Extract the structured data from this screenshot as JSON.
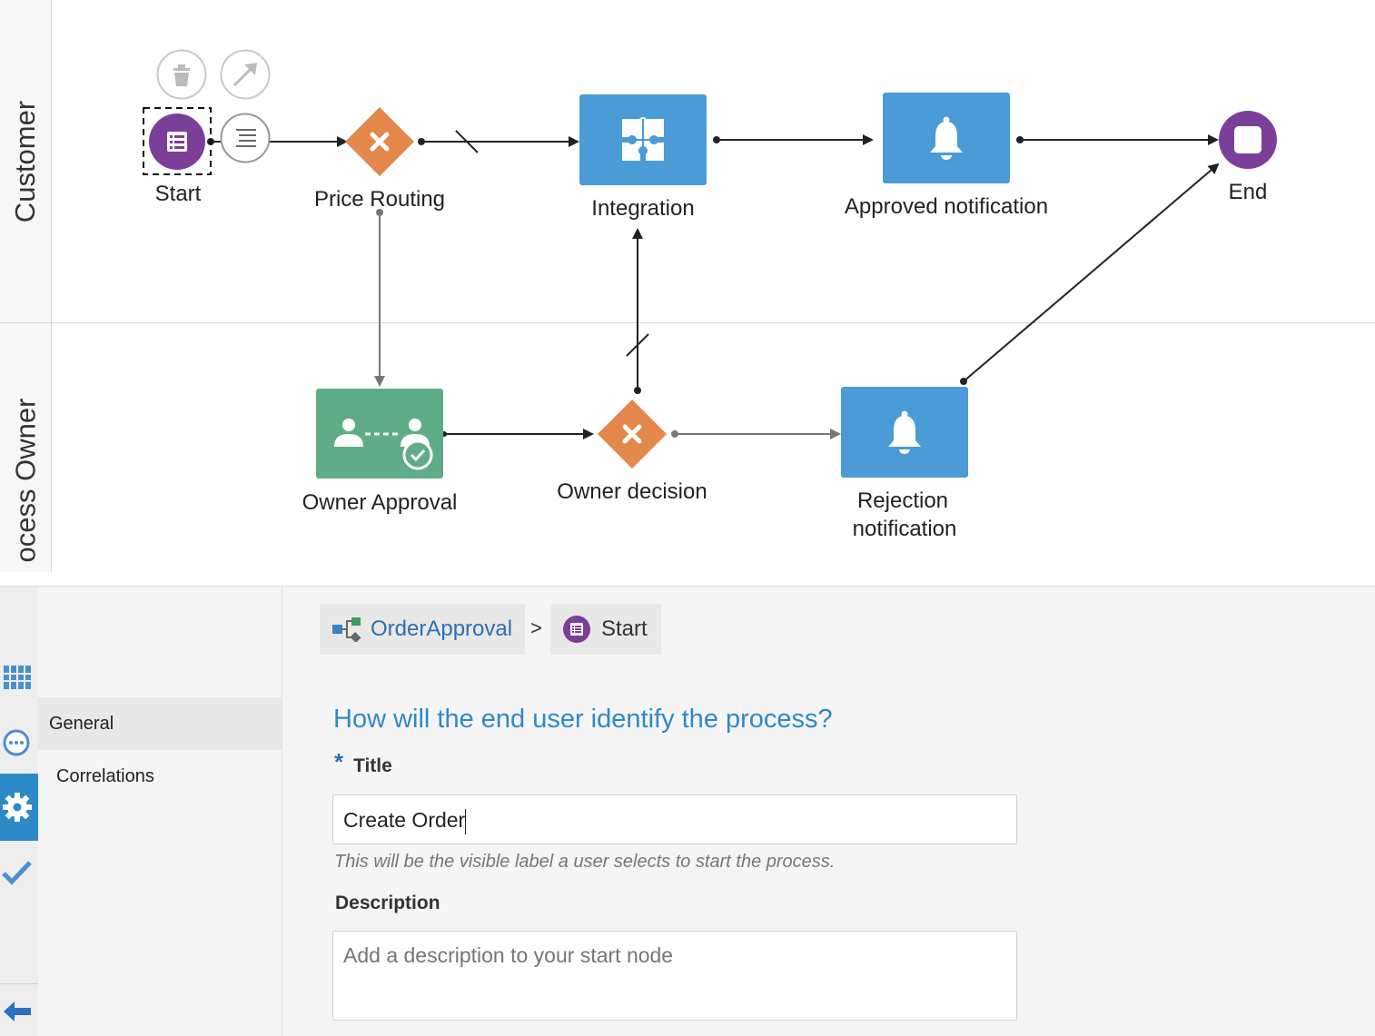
{
  "lanes": {
    "customer": "Customer",
    "process_owner": "ocess Owner"
  },
  "nodes": {
    "start": "Start",
    "price_routing": "Price Routing",
    "integration": "Integration",
    "approved_notification": "Approved notification",
    "end": "End",
    "owner_approval": "Owner Approval",
    "owner_decision": "Owner decision",
    "rejection_line1": "Rejection",
    "rejection_line2": "notification"
  },
  "node_toolbar": {
    "icons": [
      "delete-icon",
      "connect-arrow-icon",
      "properties-icon"
    ]
  },
  "colors": {
    "start_event": "#7b3f99",
    "gateway": "#e3874a",
    "service_task": "#4a9bd6",
    "human_task": "#5fad87",
    "flow": "#222222",
    "conditional_flow": "#777777",
    "accent_text": "#2d8ac7"
  },
  "breadcrumb": {
    "process": "OrderApproval",
    "separator": ">",
    "node": "Start"
  },
  "nav": {
    "general": "General",
    "correlations": "Correlations"
  },
  "side_icons": [
    "data-objects-icon",
    "chat-icon",
    "gear-icon",
    "check-icon",
    "back-arrow-icon"
  ],
  "form": {
    "question": "How will the end user identify the process?",
    "required_mark": "*",
    "title_label": "Title",
    "title_value": "Create Order",
    "title_hint": "This will be the visible label a user selects to start the process.",
    "description_label": "Description",
    "description_placeholder": "Add a description to your start node",
    "description_value": ""
  }
}
